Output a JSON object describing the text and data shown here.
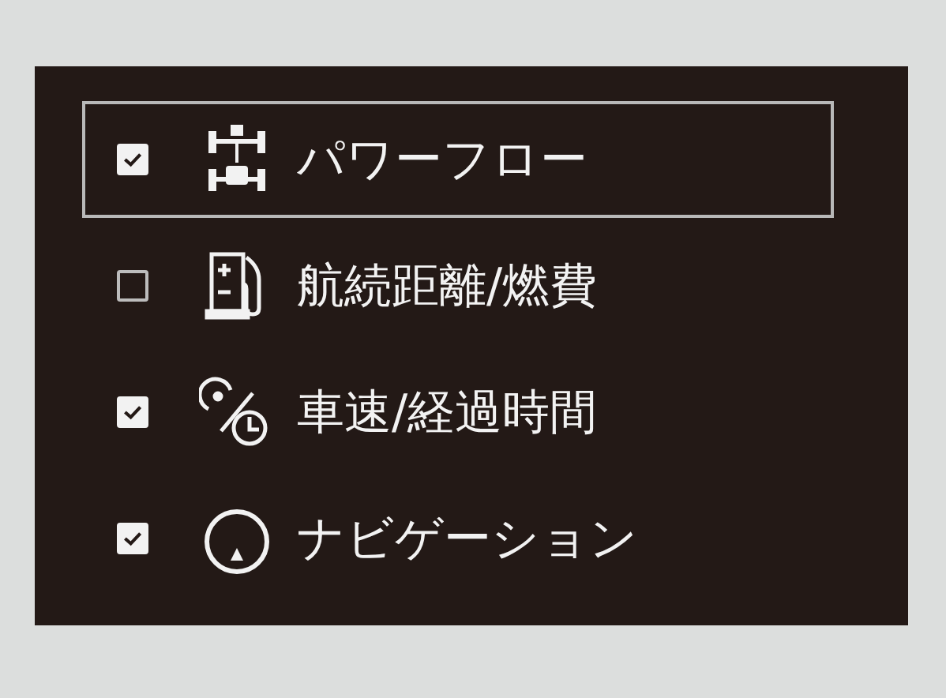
{
  "menu": {
    "items": [
      {
        "label": "パワーフロー",
        "checked": true,
        "selected": true
      },
      {
        "label": "航続距離/燃費",
        "checked": false,
        "selected": false
      },
      {
        "label": "車速/経過時間",
        "checked": true,
        "selected": false
      },
      {
        "label": "ナビゲーション",
        "checked": true,
        "selected": false
      }
    ]
  }
}
